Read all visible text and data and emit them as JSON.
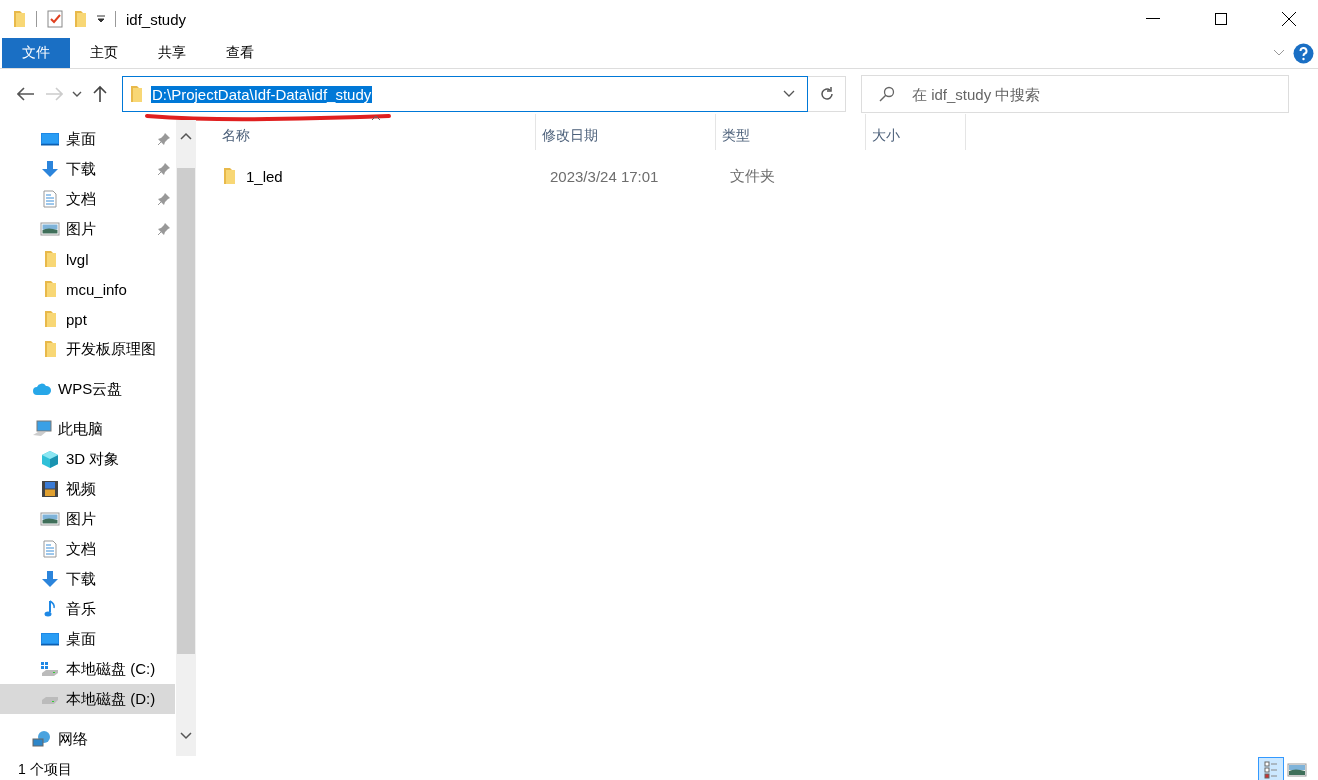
{
  "window": {
    "title": "idf_study"
  },
  "ribbon_tabs": [
    {
      "label": "文件",
      "selected": true
    },
    {
      "label": "主页",
      "selected": false
    },
    {
      "label": "共享",
      "selected": false
    },
    {
      "label": "查看",
      "selected": false
    }
  ],
  "address": {
    "value": "D:\\ProjectData\\Idf-Data\\idf_study",
    "text_selected": true,
    "annotated": true
  },
  "search": {
    "placeholder": "在 idf_study 中搜索"
  },
  "quick_access_items": [
    {
      "label": "桌面",
      "kind": "desktop",
      "pinned": true,
      "selected": false
    },
    {
      "label": "下载",
      "kind": "download",
      "pinned": true,
      "selected": false
    },
    {
      "label": "文档",
      "kind": "document",
      "pinned": true,
      "selected": false
    },
    {
      "label": "图片",
      "kind": "pictures",
      "pinned": true,
      "selected": false
    },
    {
      "label": "lvgl",
      "kind": "folder",
      "pinned": false,
      "selected": false
    },
    {
      "label": "mcu_info",
      "kind": "folder",
      "pinned": false,
      "selected": false
    },
    {
      "label": "ppt",
      "kind": "folder",
      "pinned": false,
      "selected": false
    },
    {
      "label": "开发板原理图",
      "kind": "folder",
      "pinned": false,
      "selected": false
    }
  ],
  "sidebar_items": [
    {
      "label": "WPS云盘",
      "kind": "cloud",
      "selected": false
    },
    {
      "label": "此电脑",
      "kind": "pc",
      "selected": false,
      "children": [
        {
          "label": "3D 对象",
          "kind": "cube",
          "selected": false
        },
        {
          "label": "视频",
          "kind": "video",
          "selected": false
        },
        {
          "label": "图片",
          "kind": "pictures",
          "selected": false
        },
        {
          "label": "文档",
          "kind": "document",
          "selected": false
        },
        {
          "label": "下载",
          "kind": "download",
          "selected": false
        },
        {
          "label": "音乐",
          "kind": "music",
          "selected": false
        },
        {
          "label": "桌面",
          "kind": "desktop",
          "selected": false
        },
        {
          "label": "本地磁盘 (C:)",
          "kind": "drive-c",
          "selected": false
        },
        {
          "label": "本地磁盘 (D:)",
          "kind": "drive",
          "selected": true
        }
      ]
    },
    {
      "label": "网络",
      "kind": "network",
      "selected": false
    }
  ],
  "table": {
    "columns": [
      {
        "label": "名称",
        "sorted": true
      },
      {
        "label": "修改日期",
        "sorted": false
      },
      {
        "label": "类型",
        "sorted": false
      },
      {
        "label": "大小",
        "sorted": false
      }
    ],
    "rows": [
      {
        "name": "1_led",
        "kind": "folder",
        "modified": "2023/3/24 17:01",
        "type": "文件夹"
      }
    ]
  },
  "status_bar": {
    "count": "1 个项目",
    "view_buttons": [
      {
        "kind": "details",
        "selected": true
      },
      {
        "kind": "large-icons",
        "selected": false
      }
    ]
  }
}
